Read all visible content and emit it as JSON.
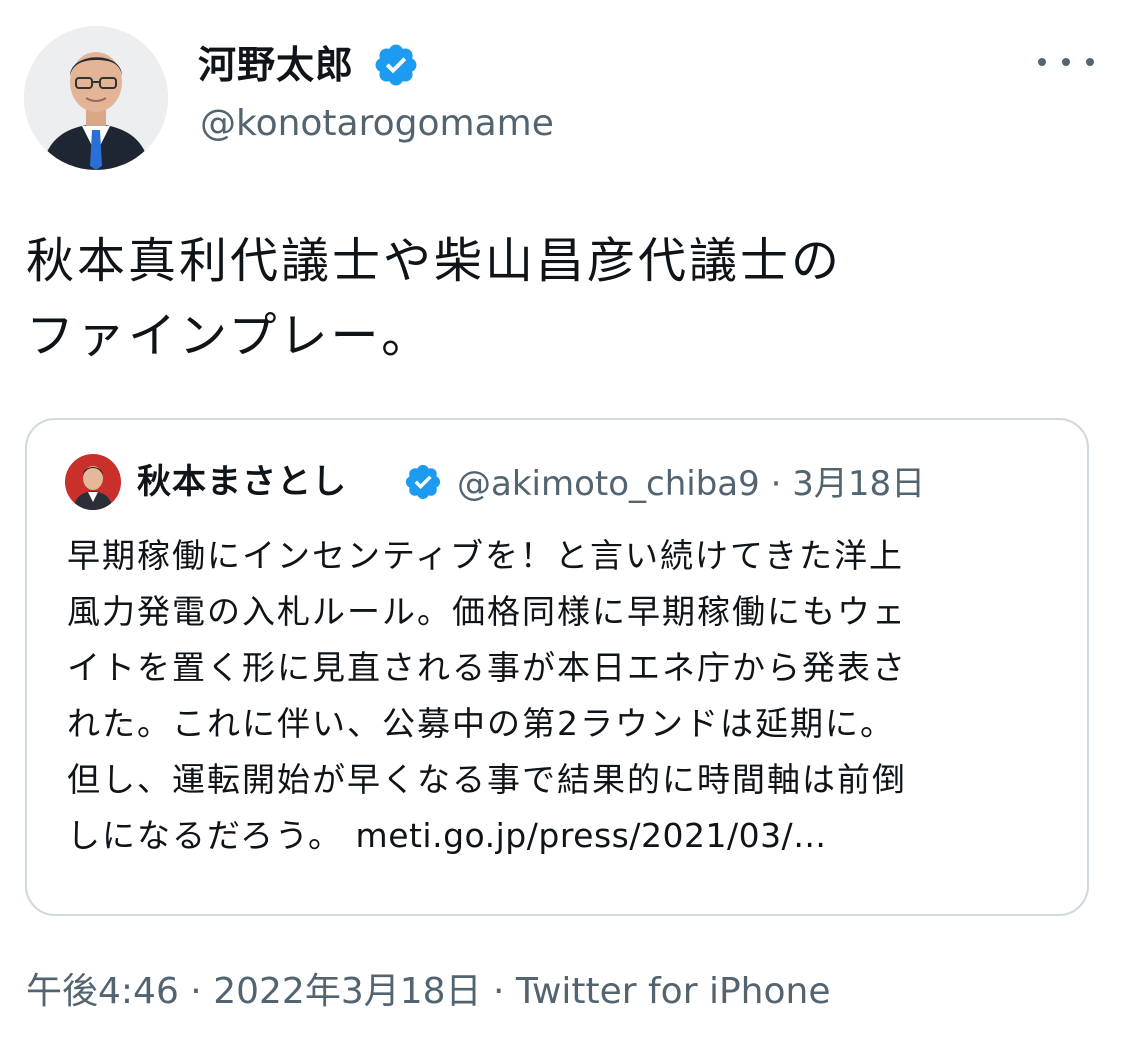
{
  "author": {
    "name": "河野太郎",
    "handle": "@konotarogomame",
    "verified": true
  },
  "tweet": {
    "lines": [
      "秋本真利代議士や柴山昌彦代議士の",
      "ファインプレー。"
    ]
  },
  "quote": {
    "name": "秋本まさとし",
    "handle": "@akimoto_chiba9",
    "separator": "·",
    "date": "3月18日",
    "verified": true,
    "lines": [
      "早期稼働にインセンティブを！と言い続けてきた洋上",
      "風力発電の入札ルール。価格同様に早期稼働にもウェ",
      "イトを置く形に見直される事が本日エネ庁から発表さ",
      "れた。これに伴い、公募中の第2ラウンドは延期に。",
      "但し、運転開始が早くなる事で結果的に時間軸は前倒"
    ],
    "last_line_text": "しになるだろう。",
    "link": "meti.go.jp/press/2021/03/…"
  },
  "footer": {
    "time": "午後4:46",
    "date": "2022年3月18日",
    "source": "Twitter for iPhone",
    "separator": "·"
  },
  "icons": {
    "verified": "verified-badge-icon",
    "more": "more-horizontal-icon"
  },
  "colors": {
    "text_primary": "#0f1419",
    "text_secondary": "#536471",
    "verified_blue": "#1d9bf0",
    "card_border": "#cfd9de"
  }
}
